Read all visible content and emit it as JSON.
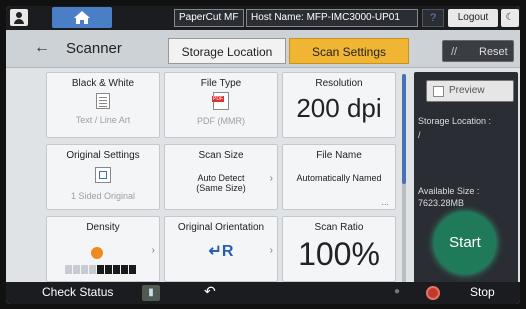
{
  "system_bar": {
    "app_name": "PaperCut MF",
    "host_name": "Host Name: MFP-IMC3000-UP01",
    "help": "?",
    "logout": "Logout",
    "moon": "☾"
  },
  "header": {
    "back": "←",
    "title": "Scanner",
    "tabs": [
      {
        "label": "Storage Location",
        "active": false
      },
      {
        "label": "Scan Settings",
        "active": true
      }
    ],
    "reset_label": "Reset",
    "reset_icon": "//"
  },
  "settings": {
    "bw": {
      "caption": "Black & White",
      "value": "Text / Line Art"
    },
    "file_type": {
      "caption": "File Type",
      "value": "PDF (MMR)"
    },
    "resolution": {
      "caption": "Resolution",
      "value": "200 dpi"
    },
    "original_settings": {
      "caption": "Original Settings",
      "value": "1 Sided Original"
    },
    "scan_size": {
      "caption": "Scan Size",
      "value_line1": "Auto Detect",
      "value_line2": "(Same Size)"
    },
    "file_name": {
      "caption": "File Name",
      "value": "Automatically Named"
    },
    "density": {
      "caption": "Density",
      "level": 4,
      "steps": 9
    },
    "orientation": {
      "caption": "Original Orientation",
      "value": "↵R"
    },
    "scan_ratio": {
      "caption": "Scan Ratio",
      "value": "100%"
    }
  },
  "chevron": "›",
  "more": "...",
  "side_panel": {
    "preview_label": "Preview",
    "storage_location_label": "Storage Location :",
    "storage_location_value": "/",
    "available_size_label": "Available Size :",
    "available_size_value": "7623.28MB",
    "start_label": "Start"
  },
  "bottom_bar": {
    "check_status": "Check Status",
    "stop": "Stop"
  },
  "colors": {
    "active_tab": "#f0b633",
    "start": "#1f7a5a",
    "stop": "#c0392b",
    "home": "#4a7fc7"
  }
}
